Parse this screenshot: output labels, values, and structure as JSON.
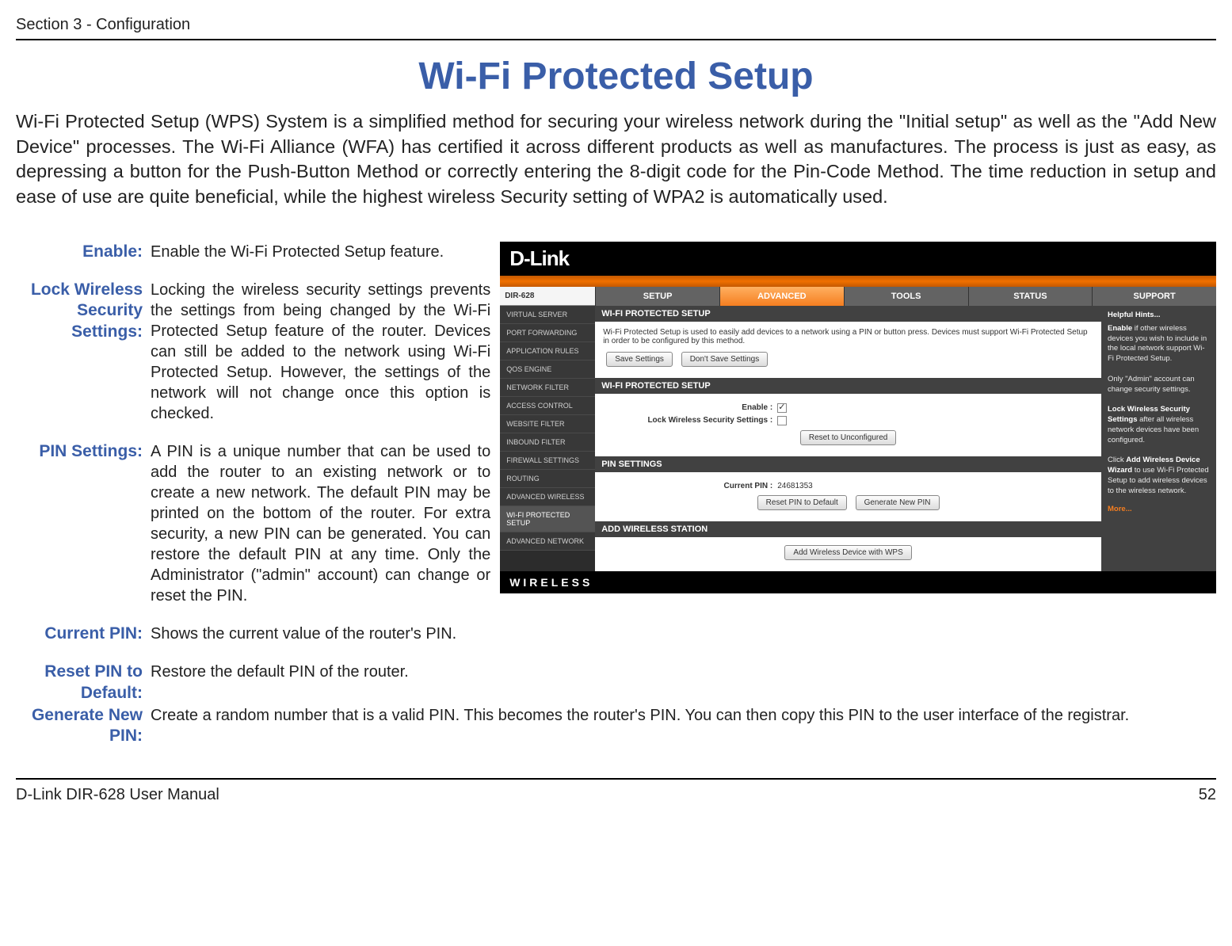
{
  "header": {
    "left": "Section 3 - Configuration"
  },
  "title": "Wi-Fi Protected Setup",
  "intro": "Wi-Fi Protected Setup (WPS) System is a simplified method for securing your wireless network during the \"Initial setup\" as well as the \"Add New Device\" processes. The Wi-Fi Alliance (WFA) has certified it across different products as well as manufactures. The process is just as easy, as depressing a button for the Push-Button Method or correctly entering the 8-digit code for the Pin-Code Method.  The time reduction in setup and ease of use are quite beneficial, while the highest wireless Security setting of WPA2 is automatically used.",
  "defs": {
    "enable": {
      "label": "Enable:",
      "desc": "Enable the Wi-Fi Protected Setup feature."
    },
    "lock": {
      "label": "Lock Wireless Security Settings:",
      "desc": "Locking the wireless security settings prevents the settings from being changed by the Wi-Fi Protected Setup feature of the router. Devices can still be added to the network using Wi-Fi Protected Setup. However, the settings of the network will not change once this option is checked."
    },
    "pin": {
      "label": "PIN Settings:",
      "desc": "A PIN is a unique number that can be used to add the router to an existing network or to create a new network. The default PIN may be printed on the bottom of the router. For extra security, a new PIN can be generated. You can restore the default PIN at any time. Only the Administrator (\"admin\" account) can change or reset the PIN."
    },
    "curpin": {
      "label": "Current PIN:",
      "desc": "Shows the current value of the router's PIN."
    },
    "reset": {
      "label": "Reset PIN to Default:",
      "desc": "Restore the default PIN of the router."
    },
    "gen": {
      "label": "Generate New PIN:",
      "desc": "Create a random number that is a valid PIN. This becomes the router's PIN. You can then copy this PIN to the user interface of the registrar."
    }
  },
  "footer": {
    "left": "D-Link DIR-628 User Manual",
    "right": "52"
  },
  "router": {
    "logo": "D-Link",
    "model": "DIR-628",
    "tabs": [
      "SETUP",
      "ADVANCED",
      "TOOLS",
      "STATUS",
      "SUPPORT"
    ],
    "side": [
      "VIRTUAL SERVER",
      "PORT FORWARDING",
      "APPLICATION RULES",
      "QOS ENGINE",
      "NETWORK FILTER",
      "ACCESS CONTROL",
      "WEBSITE FILTER",
      "INBOUND FILTER",
      "FIREWALL SETTINGS",
      "ROUTING",
      "ADVANCED WIRELESS",
      "WI-FI PROTECTED SETUP",
      "ADVANCED NETWORK"
    ],
    "panel1": {
      "title": "WI-FI PROTECTED SETUP",
      "text": "Wi-Fi Protected Setup is used to easily add devices to a network using a PIN or button press. Devices must support Wi-Fi Protected Setup in order to be configured by this method.",
      "btn1": "Save Settings",
      "btn2": "Don't Save Settings"
    },
    "panel2": {
      "title": "WI-FI PROTECTED SETUP",
      "f1": "Enable :",
      "f2": "Lock Wireless Security Settings :",
      "btn": "Reset to Unconfigured"
    },
    "panel3": {
      "title": "PIN SETTINGS",
      "f1": "Current PIN :",
      "pin": "24681353",
      "btn1": "Reset PIN to Default",
      "btn2": "Generate New PIN"
    },
    "panel4": {
      "title": "ADD WIRELESS STATION",
      "btn": "Add Wireless Device with WPS"
    },
    "help": {
      "title": "Helpful Hints...",
      "p1a": "Enable",
      "p1b": " if other wireless devices you wish to include in the local network support Wi-Fi Protected Setup.",
      "p2": "Only \"Admin\" account can change security settings.",
      "p3a": "Lock Wireless Security Settings",
      "p3b": " after all wireless network devices have been configured.",
      "p4a": "Click ",
      "p4b": "Add Wireless Device Wizard",
      "p4c": " to use Wi-Fi Protected Setup to add wireless devices to the wireless network.",
      "more": "More..."
    },
    "bottom": "WIRELESS"
  }
}
